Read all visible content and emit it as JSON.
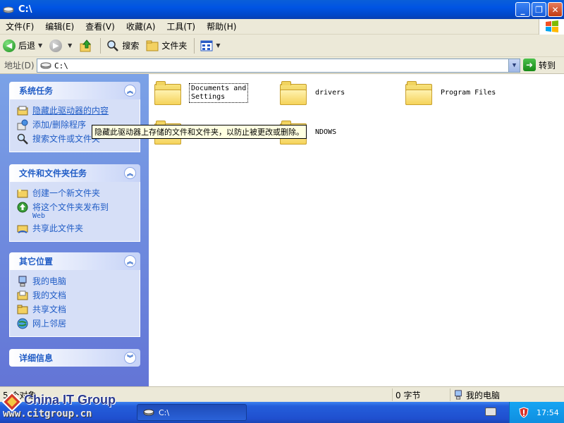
{
  "window": {
    "title": "C:\\"
  },
  "menu": [
    "文件(F)",
    "编辑(E)",
    "查看(V)",
    "收藏(A)",
    "工具(T)",
    "帮助(H)"
  ],
  "toolbar": {
    "back": "后退",
    "search": "搜索",
    "folders": "文件夹"
  },
  "address": {
    "label": "地址(D)",
    "value": "C:\\",
    "go": "转到"
  },
  "panels": {
    "system_tasks": {
      "title": "系统任务",
      "items": [
        "隐藏此驱动器的内容",
        "添加/删除程序",
        "搜索文件或文件夹"
      ]
    },
    "file_tasks": {
      "title": "文件和文件夹任务",
      "items": [
        "创建一个新文件夹",
        "将这个文件夹发布到",
        "共享此文件夹"
      ],
      "publish_sub": "Web"
    },
    "other_places": {
      "title": "其它位置",
      "items": [
        "我的电脑",
        "我的文档",
        "共享文档",
        "网上邻居"
      ]
    },
    "details": {
      "title": "详细信息"
    }
  },
  "folders": [
    {
      "name1": "Documents and",
      "name2": "Settings"
    },
    {
      "name1": "drivers",
      "name2": ""
    },
    {
      "name1": "Program Files",
      "name2": ""
    },
    {
      "name1": "",
      "name2": ""
    },
    {
      "name1": "NDOWS",
      "name2": ""
    }
  ],
  "tooltip": "隐藏此驱动器上存储的文件和文件夹，以防止被更改或删除。",
  "status": {
    "objects": "5 个对象",
    "size": "0 字节",
    "location": "我的电脑"
  },
  "taskbar": {
    "window_button": "C:\\",
    "clock": "17:54"
  },
  "watermark": {
    "line1": "China IT Group",
    "line2": "www.citgroup.cn"
  }
}
